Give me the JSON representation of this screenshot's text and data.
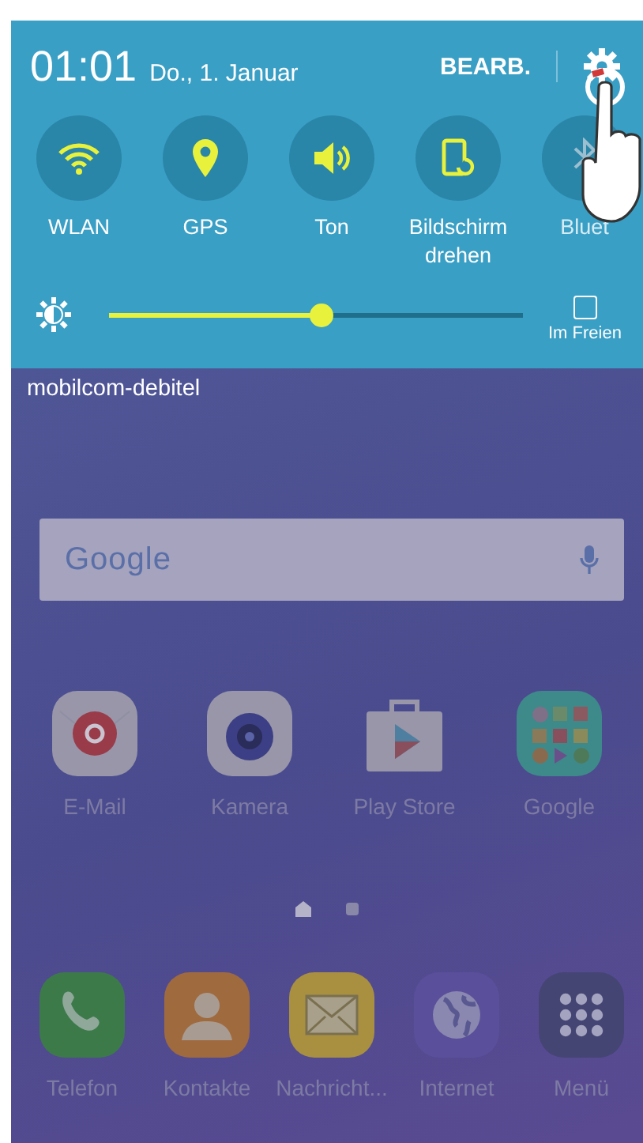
{
  "status_header": {
    "time": "01:01",
    "date": "Do., 1. Januar",
    "edit_button": "BEARB."
  },
  "quick_toggles": [
    {
      "label": "WLAN",
      "kind": "wifi",
      "on": true
    },
    {
      "label": "GPS",
      "kind": "location",
      "on": true
    },
    {
      "label": "Ton",
      "kind": "sound",
      "on": true
    },
    {
      "label": "Bildschirm drehen",
      "kind": "rotate",
      "on": true
    },
    {
      "label": "Bluet",
      "kind": "bluetooth",
      "on": false
    }
  ],
  "brightness": {
    "level": 0.51,
    "outdoor": {
      "label": "Im Freien",
      "checked": false
    }
  },
  "carrier": "mobilcom-debitel",
  "search_bar": {
    "logo": "Google"
  },
  "apps": [
    {
      "label": "E-Mail",
      "kind": "email"
    },
    {
      "label": "Kamera",
      "kind": "camera"
    },
    {
      "label": "Play Store",
      "kind": "store"
    },
    {
      "label": "Google",
      "kind": "folder"
    }
  ],
  "page_indicator": [
    {
      "kind": "home",
      "selected": true
    },
    {
      "kind": "page",
      "selected": false
    }
  ],
  "dock": [
    {
      "label": "Telefon",
      "kind": "phone"
    },
    {
      "label": "Kontakte",
      "kind": "contacts"
    },
    {
      "label": "Nachricht...",
      "kind": "messages"
    },
    {
      "label": "Internet",
      "kind": "internet"
    },
    {
      "label": "Menü",
      "kind": "menu"
    }
  ]
}
